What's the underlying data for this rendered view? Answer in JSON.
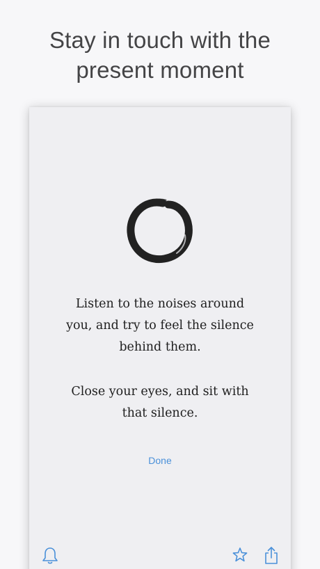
{
  "headline": {
    "line1": "Stay in touch with the",
    "line2": "present moment"
  },
  "card": {
    "logo_icon": "enso-circle-icon",
    "message_1": [
      "Listen to the noises around",
      "you, and try to feel the silence",
      "behind them."
    ],
    "message_2": [
      "Close your eyes, and sit with",
      "that silence."
    ],
    "done_label": "Done"
  },
  "toolbar": {
    "icons": [
      "bell-icon",
      "star-icon",
      "share-icon"
    ]
  },
  "colors": {
    "accent": "#4a90d9",
    "background": "#f7f7f9",
    "card": "#efeff2",
    "headline_text": "#444446",
    "body_text": "#1e1e1e"
  }
}
